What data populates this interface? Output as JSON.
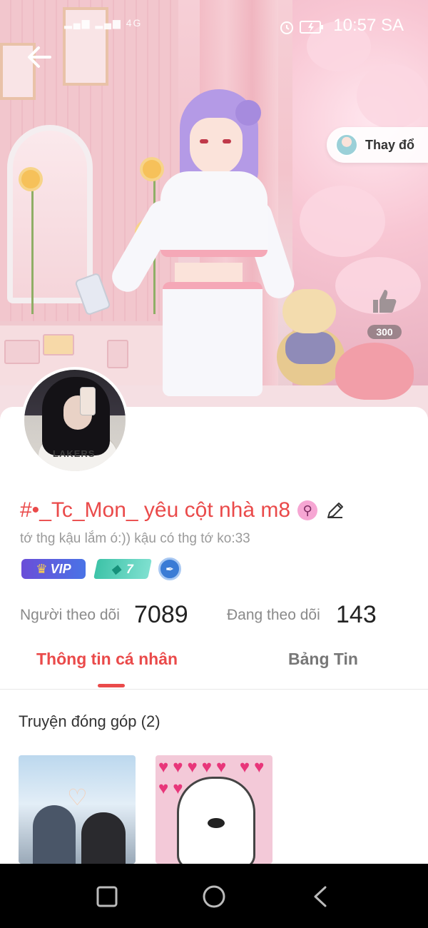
{
  "status_bar": {
    "signal": "4G",
    "time": "10:57 SA"
  },
  "cover": {
    "change_label": "Thay đổ",
    "like_count": "300"
  },
  "profile": {
    "name": "#•_Tc_Mon_ yêu cột nhà m8",
    "gender_symbol": "⚲",
    "bio": "tớ thg kậu lắm ó:)) kậu có thg tớ ko:33",
    "badges": {
      "vip_label": "VIP",
      "level": "7"
    },
    "avatar_text": "LAKERS"
  },
  "stats": {
    "followers_label": "Người theo dõi",
    "followers_value": "7089",
    "following_label": "Đang theo dõi",
    "following_value": "143"
  },
  "tabs": [
    {
      "label": "Thông tin cá nhân",
      "active": true
    },
    {
      "label": "Bảng Tin",
      "active": false
    }
  ],
  "contributions": {
    "title": "Truyện đóng góp (2)"
  },
  "colors": {
    "accent": "#ea4a4a",
    "vip": "#6a4ed8",
    "level": "#3ec3a8"
  },
  "icons": [
    "back-arrow-icon",
    "alarm-icon",
    "battery-icon",
    "thumbs-up-icon",
    "edit-icon",
    "gender-icon",
    "square-icon",
    "circle-icon",
    "back-triangle-icon"
  ]
}
